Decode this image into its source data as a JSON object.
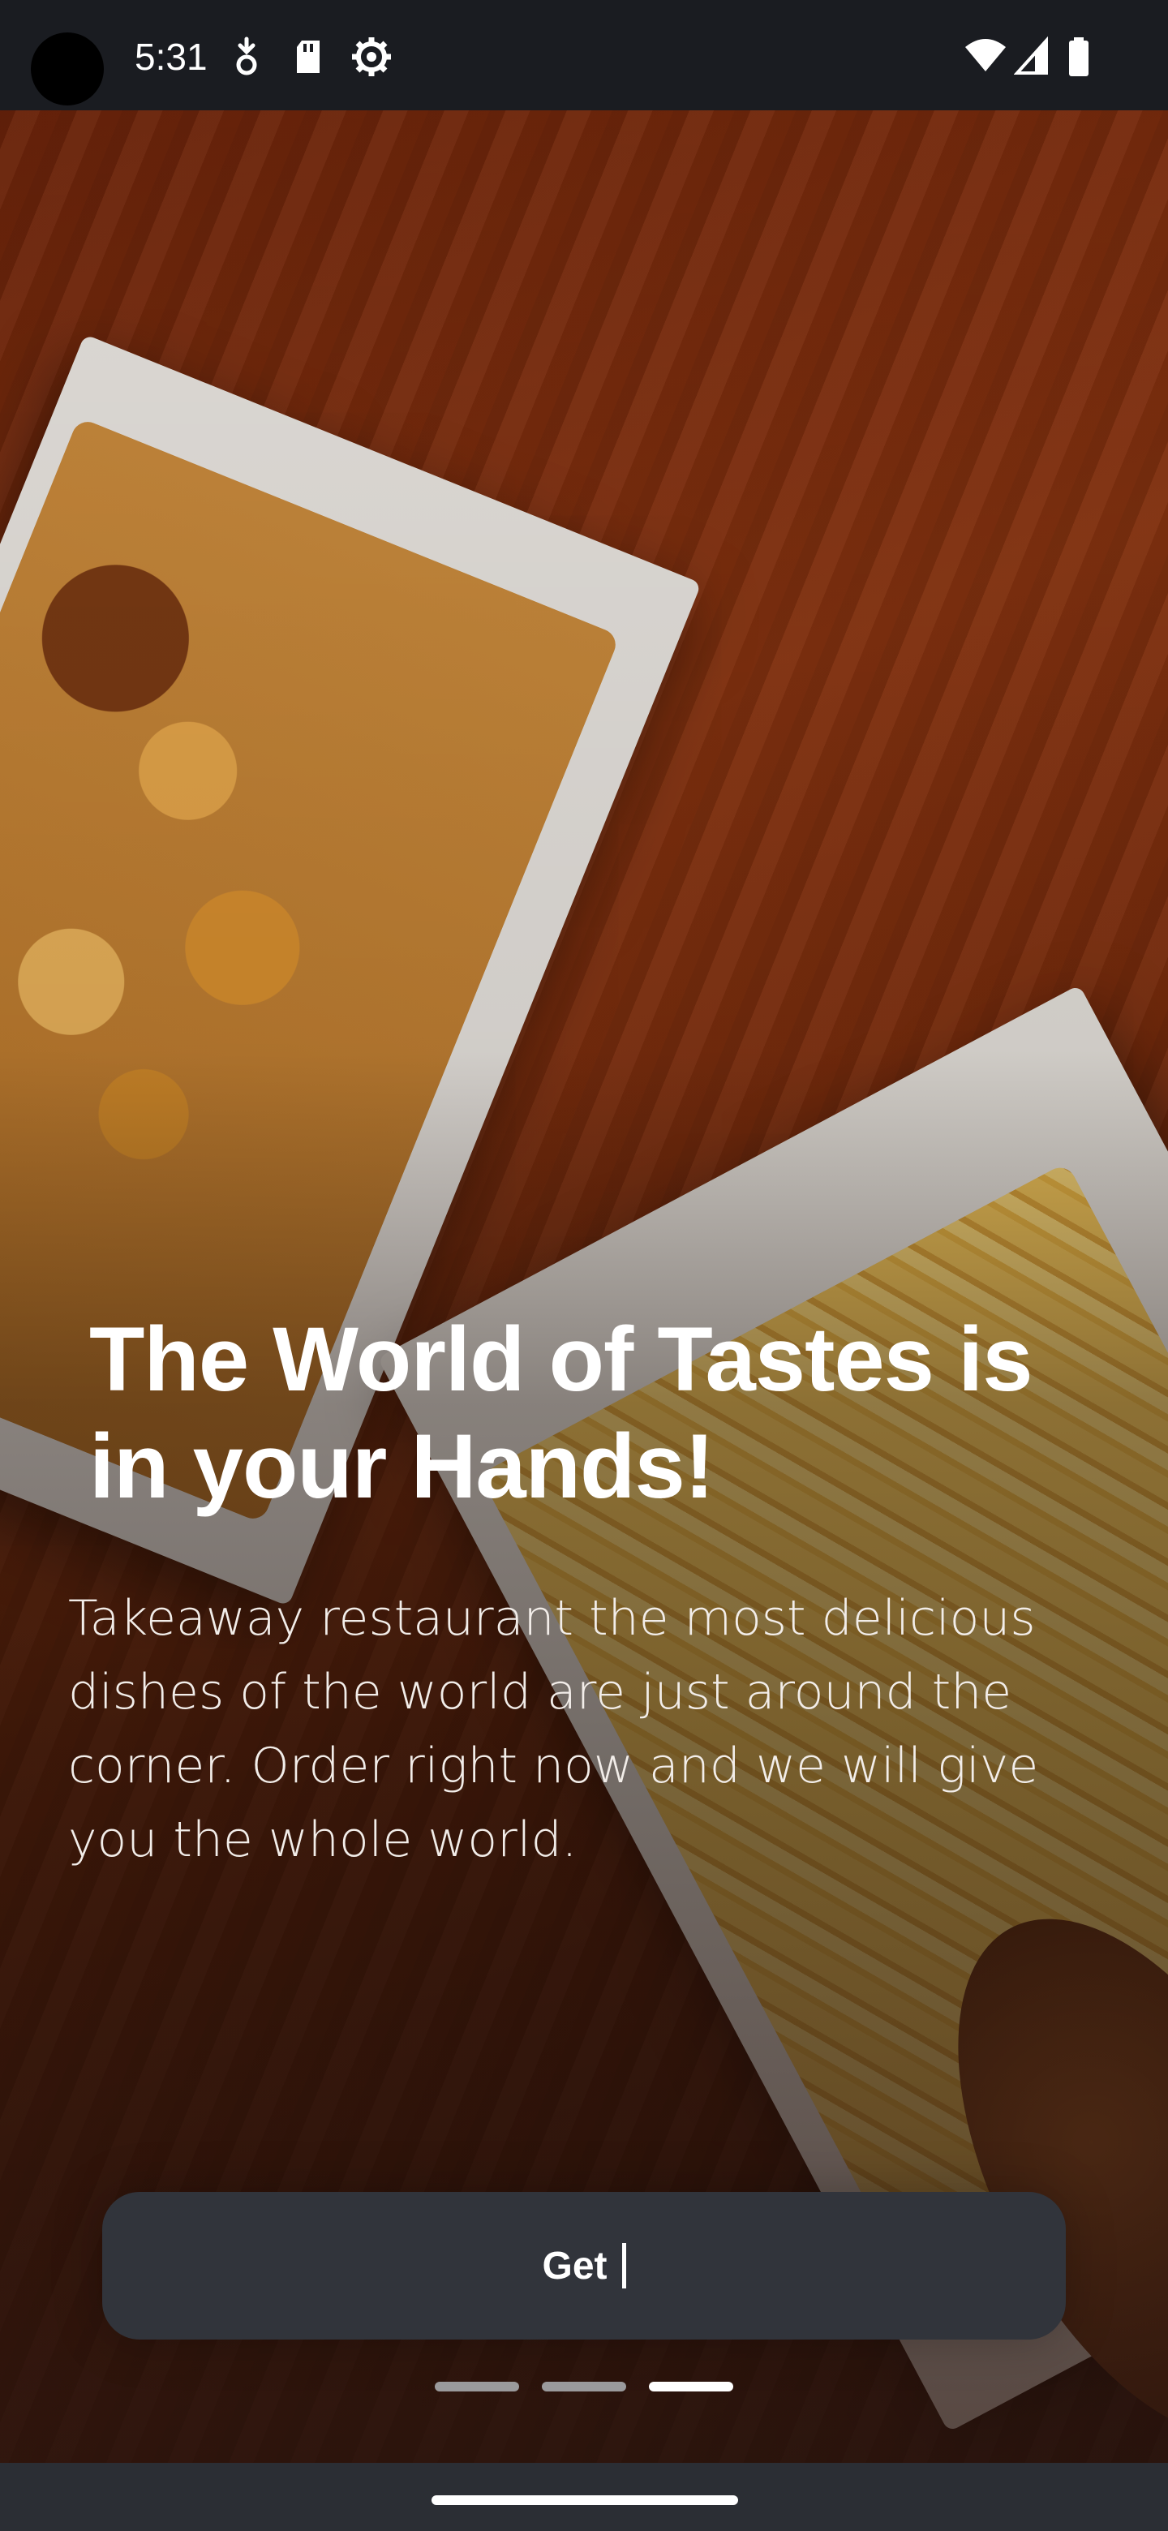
{
  "status_bar": {
    "time": "5:31",
    "left_icons": [
      "data-saver-icon",
      "sd-card-icon",
      "settings-gear-icon"
    ],
    "right_icons": [
      "wifi-icon",
      "cell-signal-icon",
      "battery-icon"
    ]
  },
  "hero": {
    "image": "food-photo-fries-wedges-chicken",
    "headline": "The World of Tastes is in your Hands!",
    "description": "Takeaway restaurant the most delicious dishes of the world are just around the corner. Order right now and we will give you the whole world."
  },
  "cta": {
    "label": "Get"
  },
  "pager": {
    "total": 3,
    "active_index": 2
  },
  "colors": {
    "status_bar_bg": "#1a1c21",
    "button_bg": "#31343b",
    "nav_bar_bg": "#2b2e34",
    "dot_active": "#ffffff",
    "dot_inactive": "#9a9a9c"
  }
}
